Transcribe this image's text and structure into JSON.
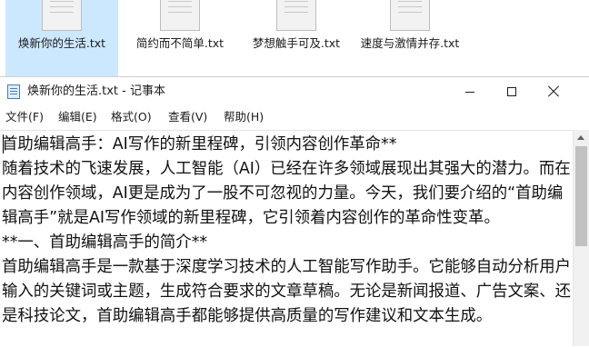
{
  "explorer": {
    "files": [
      {
        "name": "焕新你的生活.txt",
        "selected": true,
        "icon": "text-file-icon"
      },
      {
        "name": "简约而不简单.txt",
        "selected": false,
        "icon": "text-file-icon"
      },
      {
        "name": "梦想触手可及.txt",
        "selected": false,
        "icon": "text-file-icon"
      },
      {
        "name": "速度与激情并存.txt",
        "selected": false,
        "icon": "text-file-icon"
      }
    ]
  },
  "window": {
    "title": "焕新你的生活.txt - 记事本",
    "icon": "notepad-icon",
    "controls": {
      "minimize": "minimize-icon",
      "maximize": "maximize-icon",
      "close": "close-icon"
    }
  },
  "menu": {
    "file": "文件(F)",
    "edit": "编辑(E)",
    "format": "格式(O)",
    "view": "查看(V)",
    "help": "帮助(H)"
  },
  "document": {
    "text": "首助编辑高手：AI写作的新里程碑，引领内容创作革命**\n随着技术的飞速发展，人工智能（AI）已经在许多领域展现出其强大的潜力。而在内容创作领域，AI更是成为了一股不可忽视的力量。今天，我们要介绍的“首助编辑高手”就是AI写作领域的新里程碑，它引领着内容创作的革命性变革。\n**一、首助编辑高手的简介**\n首助编辑高手是一款基于深度学习技术的人工智能写作助手。它能够自动分析用户输入的关键词或主题，生成符合要求的文章草稿。无论是新闻报道、广告文案、还是科技论文，首助编辑高手都能够提供高质量的写作建议和文本生成。"
  },
  "colors": {
    "selection": "#cce8ff",
    "scrollbar_thumb": "#c1c1c1"
  }
}
